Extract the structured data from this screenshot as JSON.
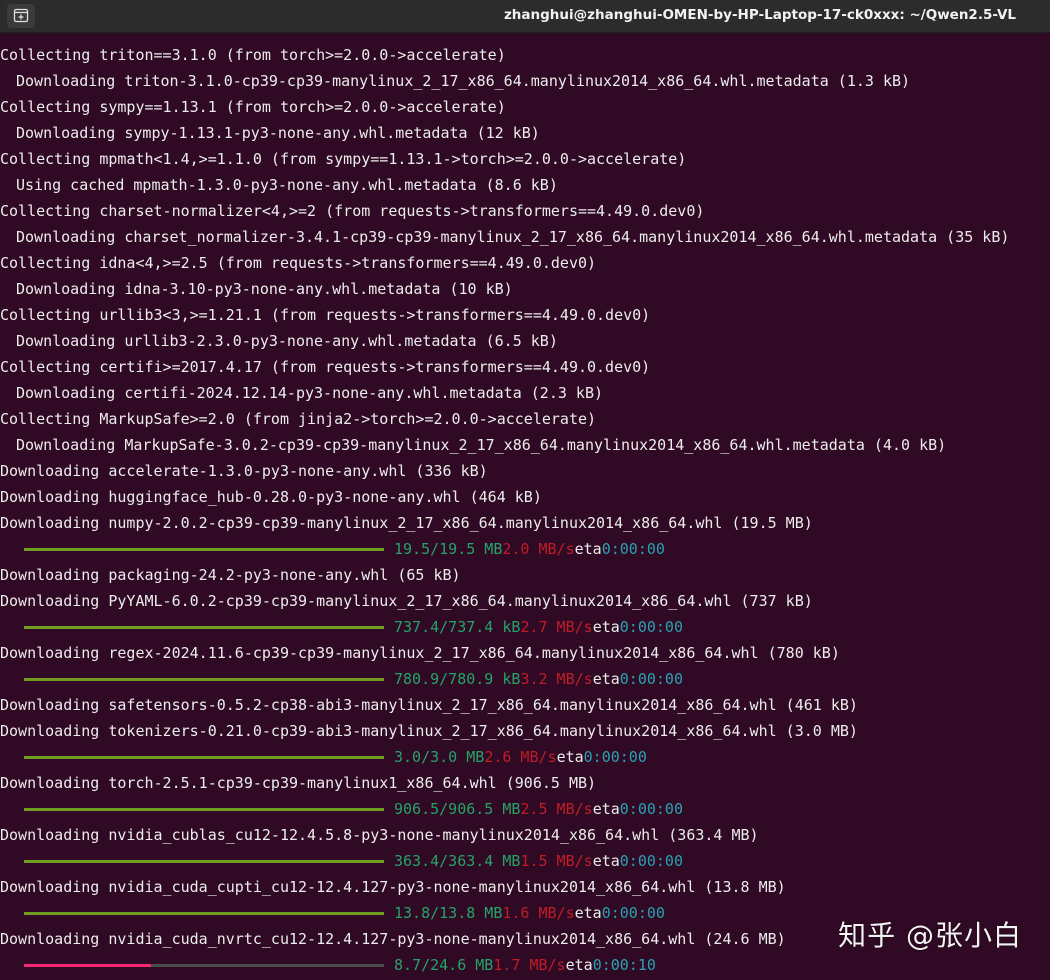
{
  "window": {
    "title": "zhanghui@zhanghui-OMEN-by-HP-Laptop-17-ck0xxx: ~/Qwen2.5-VL",
    "new_tab_icon": "new-tab-icon"
  },
  "colors": {
    "background": "#300a24",
    "text": "#ececec",
    "bar_complete": "#729c1f",
    "bar_partial": "#f92672",
    "size": "#26a269",
    "rate": "#c01c28",
    "eta": "#2aa1b3"
  },
  "lines": [
    {
      "type": "text",
      "text": "Collecting triton==3.1.0 (from torch>=2.0.0->accelerate)"
    },
    {
      "type": "text",
      "indent": true,
      "text": "Downloading triton-3.1.0-cp39-cp39-manylinux_2_17_x86_64.manylinux2014_x86_64.whl.metadata (1.3 kB)"
    },
    {
      "type": "text",
      "text": "Collecting sympy==1.13.1 (from torch>=2.0.0->accelerate)"
    },
    {
      "type": "text",
      "indent": true,
      "text": "Downloading sympy-1.13.1-py3-none-any.whl.metadata (12 kB)"
    },
    {
      "type": "text",
      "text": "Collecting mpmath<1.4,>=1.1.0 (from sympy==1.13.1->torch>=2.0.0->accelerate)"
    },
    {
      "type": "text",
      "indent": true,
      "text": "Using cached mpmath-1.3.0-py3-none-any.whl.metadata (8.6 kB)"
    },
    {
      "type": "text",
      "text": "Collecting charset-normalizer<4,>=2 (from requests->transformers==4.49.0.dev0)"
    },
    {
      "type": "text",
      "indent": true,
      "text": "Downloading charset_normalizer-3.4.1-cp39-cp39-manylinux_2_17_x86_64.manylinux2014_x86_64.whl.metadata (35 kB)"
    },
    {
      "type": "text",
      "text": "Collecting idna<4,>=2.5 (from requests->transformers==4.49.0.dev0)"
    },
    {
      "type": "text",
      "indent": true,
      "text": "Downloading idna-3.10-py3-none-any.whl.metadata (10 kB)"
    },
    {
      "type": "text",
      "text": "Collecting urllib3<3,>=1.21.1 (from requests->transformers==4.49.0.dev0)"
    },
    {
      "type": "text",
      "indent": true,
      "text": "Downloading urllib3-2.3.0-py3-none-any.whl.metadata (6.5 kB)"
    },
    {
      "type": "text",
      "text": "Collecting certifi>=2017.4.17 (from requests->transformers==4.49.0.dev0)"
    },
    {
      "type": "text",
      "indent": true,
      "text": "Downloading certifi-2024.12.14-py3-none-any.whl.metadata (2.3 kB)"
    },
    {
      "type": "text",
      "text": "Collecting MarkupSafe>=2.0 (from jinja2->torch>=2.0.0->accelerate)"
    },
    {
      "type": "text",
      "indent": true,
      "text": "Downloading MarkupSafe-3.0.2-cp39-cp39-manylinux_2_17_x86_64.manylinux2014_x86_64.whl.metadata (4.0 kB)"
    },
    {
      "type": "text",
      "text": "Downloading accelerate-1.3.0-py3-none-any.whl (336 kB)"
    },
    {
      "type": "text",
      "text": "Downloading huggingface_hub-0.28.0-py3-none-any.whl (464 kB)"
    },
    {
      "type": "text",
      "text": "Downloading numpy-2.0.2-cp39-cp39-manylinux_2_17_x86_64.manylinux2014_x86_64.whl (19.5 MB)"
    },
    {
      "type": "progress",
      "progress": 1.0,
      "size": "19.5/19.5 MB",
      "rate": "2.0 MB/s",
      "eta_label": "eta",
      "eta": "0:00:00"
    },
    {
      "type": "text",
      "text": "Downloading packaging-24.2-py3-none-any.whl (65 kB)"
    },
    {
      "type": "text",
      "text": "Downloading PyYAML-6.0.2-cp39-cp39-manylinux_2_17_x86_64.manylinux2014_x86_64.whl (737 kB)"
    },
    {
      "type": "progress",
      "progress": 1.0,
      "size": "737.4/737.4 kB",
      "rate": "2.7 MB/s",
      "eta_label": "eta",
      "eta": "0:00:00"
    },
    {
      "type": "text",
      "text": "Downloading regex-2024.11.6-cp39-cp39-manylinux_2_17_x86_64.manylinux2014_x86_64.whl (780 kB)"
    },
    {
      "type": "progress",
      "progress": 1.0,
      "size": "780.9/780.9 kB",
      "rate": "3.2 MB/s",
      "eta_label": "eta",
      "eta": "0:00:00"
    },
    {
      "type": "text",
      "text": "Downloading safetensors-0.5.2-cp38-abi3-manylinux_2_17_x86_64.manylinux2014_x86_64.whl (461 kB)"
    },
    {
      "type": "text",
      "text": "Downloading tokenizers-0.21.0-cp39-abi3-manylinux_2_17_x86_64.manylinux2014_x86_64.whl (3.0 MB)"
    },
    {
      "type": "progress",
      "progress": 1.0,
      "size": "3.0/3.0 MB",
      "rate": "2.6 MB/s",
      "eta_label": "eta",
      "eta": "0:00:00"
    },
    {
      "type": "text",
      "text": "Downloading torch-2.5.1-cp39-cp39-manylinux1_x86_64.whl (906.5 MB)"
    },
    {
      "type": "progress",
      "progress": 1.0,
      "size": "906.5/906.5 MB",
      "rate": "2.5 MB/s",
      "eta_label": "eta",
      "eta": "0:00:00"
    },
    {
      "type": "text",
      "text": "Downloading nvidia_cublas_cu12-12.4.5.8-py3-none-manylinux2014_x86_64.whl (363.4 MB)"
    },
    {
      "type": "progress",
      "progress": 1.0,
      "size": "363.4/363.4 MB",
      "rate": "1.5 MB/s",
      "eta_label": "eta",
      "eta": "0:00:00"
    },
    {
      "type": "text",
      "text": "Downloading nvidia_cuda_cupti_cu12-12.4.127-py3-none-manylinux2014_x86_64.whl (13.8 MB)"
    },
    {
      "type": "progress",
      "progress": 1.0,
      "size": "13.8/13.8 MB",
      "rate": "1.6 MB/s",
      "eta_label": "eta",
      "eta": "0:00:00"
    },
    {
      "type": "text",
      "text": "Downloading nvidia_cuda_nvrtc_cu12-12.4.127-py3-none-manylinux2014_x86_64.whl (24.6 MB)"
    },
    {
      "type": "progress",
      "progress": 0.354,
      "size": "8.7/24.6 MB",
      "rate": "1.7 MB/s",
      "eta_label": "eta",
      "eta": "0:00:10"
    }
  ],
  "watermark": "知乎 @张小白"
}
